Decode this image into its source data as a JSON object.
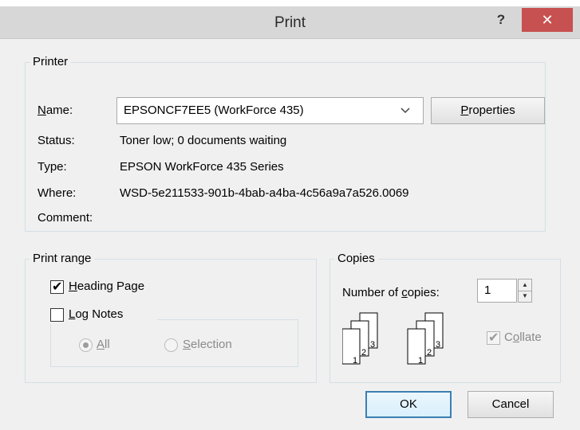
{
  "dialog": {
    "title": "Print",
    "help_label": "?",
    "close_label": "✕"
  },
  "printer": {
    "group_label": "Printer",
    "name_label": "Name:",
    "name_accel": "N",
    "name_rest": "ame:",
    "name_value": "EPSONCF7EE5 (WorkForce 435)",
    "properties_accel": "P",
    "properties_rest": "roperties",
    "status_label": "Status:",
    "status_value": "Toner low; 0 documents waiting",
    "type_label": "Type:",
    "type_value": "EPSON WorkForce 435 Series",
    "where_label": "Where:",
    "where_value": "WSD-5e211533-901b-4bab-a4ba-4c56a9a7a526.0069",
    "comment_label": "Comment:",
    "comment_value": ""
  },
  "print_range": {
    "group_label": "Print range",
    "heading_page_accel": "H",
    "heading_page_rest": "eading Page",
    "heading_page_checked": true,
    "log_notes_accel": "L",
    "log_notes_rest": "og Notes",
    "log_notes_checked": false,
    "all_accel": "A",
    "all_rest": "ll",
    "selection_accel": "S",
    "selection_rest": "election",
    "selected_option": "All"
  },
  "copies": {
    "group_label": "Copies",
    "number_label_pre": "Number of ",
    "number_accel": "c",
    "number_label_post": "opies:",
    "number_value": "1",
    "collate_pre": "C",
    "collate_accel": "o",
    "collate_rest": "llate",
    "collate_checked": true,
    "page_numbers": [
      "1",
      "2",
      "3"
    ]
  },
  "footer": {
    "ok_label": "OK",
    "cancel_label": "Cancel"
  },
  "colors": {
    "close_button": "#c75050",
    "default_button_border": "#3c7fb1",
    "group_border": "#d5dfe5"
  }
}
